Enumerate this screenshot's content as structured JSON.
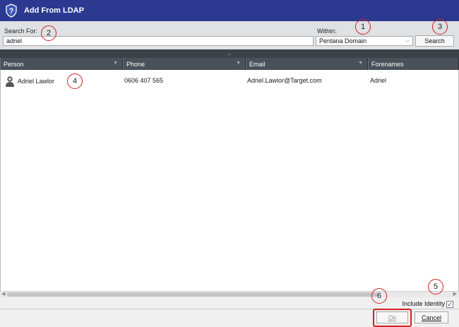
{
  "window": {
    "title": "Add From LDAP",
    "icon": "shield-question-icon"
  },
  "search": {
    "label": "Search For:",
    "value": "adriel",
    "within_label": "Within:",
    "within_value": "Pentana Domain",
    "search_button": "Search"
  },
  "grid": {
    "columns": [
      "Person",
      "Phone",
      "Email",
      "Forenames"
    ],
    "rows": [
      {
        "person": "Adriel Lawlor",
        "phone": "0606 407 565",
        "email": "Adriel.Lawlor@Target.com",
        "forenames": "Adriel"
      }
    ]
  },
  "footer": {
    "include_identity": "Include Identity",
    "include_checked": true,
    "ok": "Ok",
    "cancel": "Cancel"
  },
  "annotations": [
    "1",
    "2",
    "3",
    "4",
    "5",
    "6"
  ],
  "colors": {
    "titlebar": "#2b3990",
    "header": "#4a5158",
    "marker": "#d42020"
  }
}
